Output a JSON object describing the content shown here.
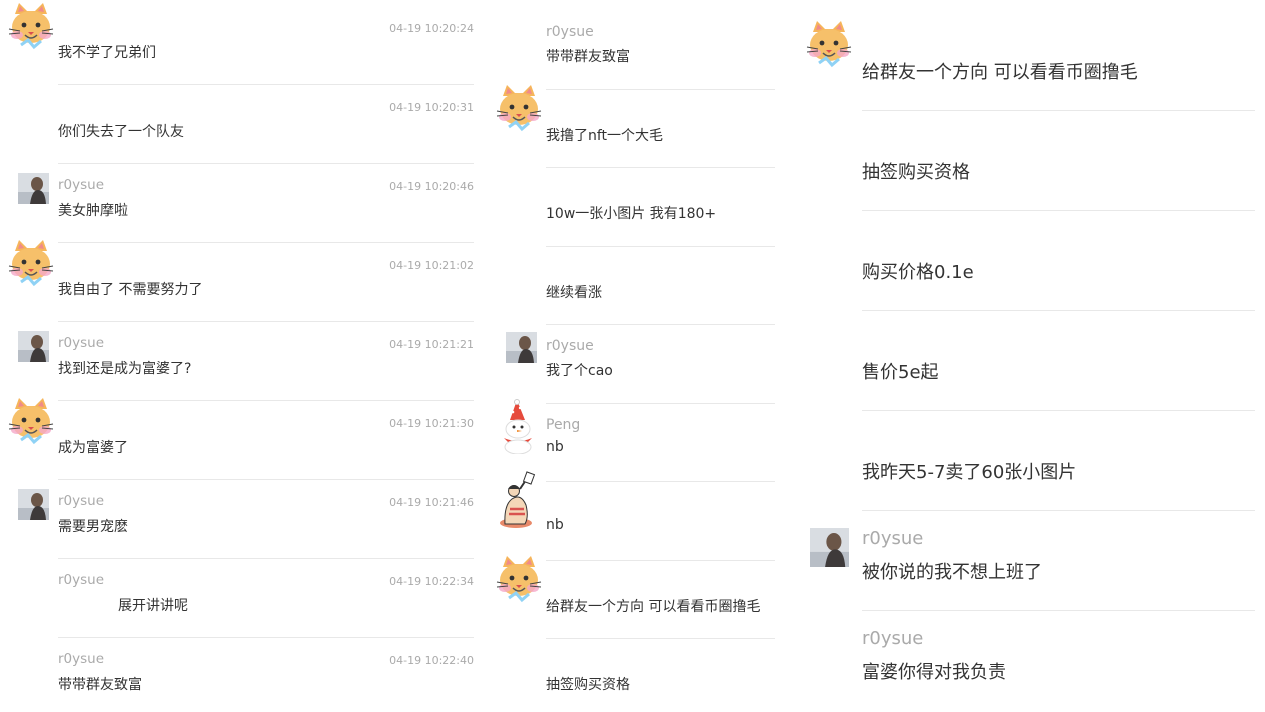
{
  "columns": [
    {
      "messages": [
        {
          "avatar": "cat",
          "name": "",
          "time": "04-19 10:20:24",
          "text": "我不学了兄弟们"
        },
        {
          "avatar": "",
          "name": "",
          "time": "04-19 10:20:31",
          "text": "你们失去了一个队友"
        },
        {
          "avatar": "photo",
          "name": "r0ysue",
          "time": "04-19 10:20:46",
          "text": "美女肿摩啦"
        },
        {
          "avatar": "cat",
          "name": "",
          "time": "04-19 10:21:02",
          "text": "我自由了 不需要努力了"
        },
        {
          "avatar": "photo",
          "name": "r0ysue",
          "time": "04-19 10:21:21",
          "text": "找到还是成为富婆了?"
        },
        {
          "avatar": "cat",
          "name": "",
          "time": "04-19 10:21:30",
          "text": "成为富婆了"
        },
        {
          "avatar": "photo",
          "name": "r0ysue",
          "time": "04-19 10:21:46",
          "text": "需要男宠麽"
        },
        {
          "avatar": "",
          "name": "r0ysue",
          "time": "04-19 10:22:34",
          "text": "展开讲讲呢",
          "indent": true
        },
        {
          "avatar": "",
          "name": "r0ysue",
          "time": "04-19 10:22:40",
          "text": "带带群友致富"
        }
      ]
    },
    {
      "messages": [
        {
          "avatar": "",
          "name": "r0ysue",
          "text": "带带群友致富"
        },
        {
          "avatar": "cat",
          "name": "",
          "text": "我撸了nft一个大毛"
        },
        {
          "avatar": "",
          "name": "",
          "text": "10w一张小图片 我有180+"
        },
        {
          "avatar": "",
          "name": "",
          "text": "继续看涨"
        },
        {
          "avatar": "photo",
          "name": "r0ysue",
          "text": "我了个cao"
        },
        {
          "avatar": "snowman",
          "name": "Peng",
          "text": "nb"
        },
        {
          "avatar": "sketch",
          "name": "",
          "text": "nb"
        },
        {
          "avatar": "cat",
          "name": "",
          "text": "给群友一个方向 可以看看币圈撸毛"
        },
        {
          "avatar": "",
          "name": "",
          "text": "抽签购买资格"
        }
      ]
    },
    {
      "messages": [
        {
          "avatar": "cat",
          "name": "",
          "text": "给群友一个方向 可以看看币圈撸毛"
        },
        {
          "avatar": "",
          "name": "",
          "text": "抽签购买资格"
        },
        {
          "avatar": "",
          "name": "",
          "text": "购买价格0.1e"
        },
        {
          "avatar": "",
          "name": "",
          "text": "售价5e起"
        },
        {
          "avatar": "",
          "name": "",
          "text": "我昨天5-7卖了60张小图片"
        },
        {
          "avatar": "photo",
          "name": "r0ysue",
          "text": "被你说的我不想上班了"
        },
        {
          "avatar": "",
          "name": "r0ysue",
          "text": "富婆你得对我负责"
        }
      ]
    }
  ]
}
